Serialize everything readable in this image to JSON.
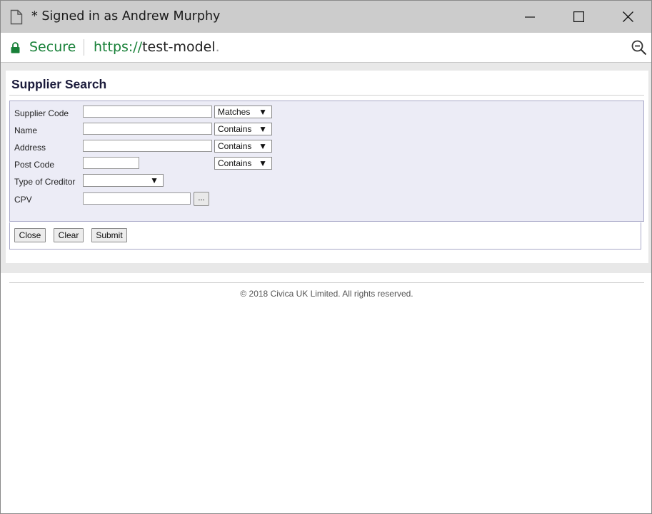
{
  "window": {
    "title": "* Signed in as Andrew Murphy"
  },
  "addressbar": {
    "secure_label": "Secure",
    "url_scheme": "https://",
    "url_host": "test-model",
    "url_fade": "."
  },
  "page": {
    "title": "Supplier Search",
    "fields": {
      "supplier_code": {
        "label": "Supplier Code",
        "value": "",
        "match": "Matches"
      },
      "name": {
        "label": "Name",
        "value": "",
        "match": "Contains"
      },
      "address": {
        "label": "Address",
        "value": "",
        "match": "Contains"
      },
      "post_code": {
        "label": "Post Code",
        "value": "",
        "match": "Contains"
      },
      "type_of_creditor": {
        "label": "Type of Creditor",
        "value": ""
      },
      "cpv": {
        "label": "CPV",
        "value": "",
        "browse_label": "..."
      }
    },
    "buttons": {
      "close": "Close",
      "clear": "Clear",
      "submit": "Submit"
    },
    "footer": "© 2018 Civica UK Limited. All rights reserved."
  },
  "colors": {
    "secure_green": "#188038",
    "title_bar": "#cccccc",
    "form_panel": "#ececf6"
  }
}
